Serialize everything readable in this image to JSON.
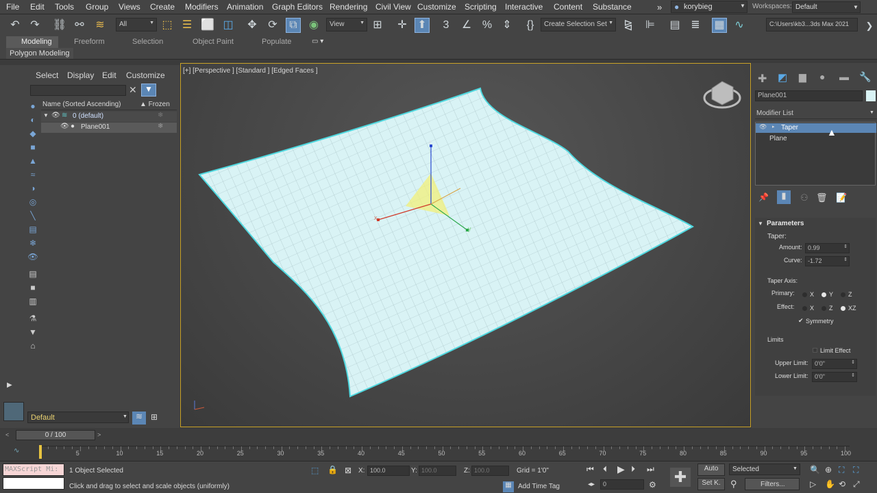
{
  "menubar": {
    "items": [
      "File",
      "Edit",
      "Tools",
      "Group",
      "Views",
      "Create",
      "Modifiers",
      "Animation",
      "Graph Editors",
      "Rendering",
      "Civil View",
      "Customize",
      "Scripting",
      "Interactive",
      "Content",
      "Substance"
    ],
    "user": "korybieg",
    "workspaces_label": "Workspaces:",
    "workspace_value": "Default"
  },
  "toolbar": {
    "filter_value": "All",
    "view_value": "View",
    "selection_set_placeholder": "Create Selection Set",
    "path": "C:\\Users\\kb3...3ds Max 2021"
  },
  "ribbon": {
    "tabs": [
      "Modeling",
      "Freeform",
      "Selection",
      "Object Paint",
      "Populate"
    ],
    "sub_label": "Polygon Modeling"
  },
  "scene_explorer": {
    "menu": [
      "Select",
      "Display",
      "Edit",
      "Customize"
    ],
    "col_name": "Name (Sorted Ascending)",
    "col_frozen": "▲ Frozen",
    "rows": [
      "0 (default)",
      "Plane001"
    ],
    "layer_value": "Default"
  },
  "viewport": {
    "label": "[+] [Perspective ] [Standard ] [Edged Faces ]",
    "gizmo_x": "x",
    "gizmo_y": "y",
    "gizmo_z": "z"
  },
  "command_panel": {
    "object_name": "Plane001",
    "modifier_list_label": "Modifier List",
    "stack": [
      "Taper",
      "Plane"
    ],
    "rollout_title": "Parameters",
    "taper_group": "Taper:",
    "amount_label": "Amount:",
    "amount_value": "0.99",
    "curve_label": "Curve:",
    "curve_value": "-1.72",
    "axis_group": "Taper Axis:",
    "primary_label": "Primary:",
    "effect_label": "Effect:",
    "primary_options": [
      "X",
      "Y",
      "Z"
    ],
    "primary_selected": "Y",
    "effect_options": [
      "X",
      "Z",
      "XZ"
    ],
    "effect_selected": "XZ",
    "symmetry_label": "Symmetry",
    "symmetry_checked": true,
    "limits_group": "Limits",
    "limit_effect_label": "Limit Effect",
    "upper_limit_label": "Upper Limit:",
    "upper_limit_value": "0'0\"",
    "lower_limit_label": "Lower Limit:",
    "lower_limit_value": "0'0\""
  },
  "timeline": {
    "frame_counter": "0 / 100",
    "ticks": [
      "0",
      "5",
      "10",
      "15",
      "20",
      "25",
      "30",
      "35",
      "40",
      "45",
      "50",
      "55",
      "60",
      "65",
      "70",
      "75",
      "80",
      "85",
      "90",
      "95",
      "100"
    ]
  },
  "status": {
    "maxscript": "MAXScript Mi:",
    "selected_text": "1 Object Selected",
    "prompt": "Click and drag to select and scale objects (uniformly)",
    "x_label": "X:",
    "x_value": "100.0",
    "y_label": "Y:",
    "y_value": "100.0",
    "z_label": "Z:",
    "z_value": "100.0",
    "grid": "Grid = 1'0\"",
    "add_time_tag": "Add Time Tag",
    "auto_label": "Auto",
    "setk_label": "Set K.",
    "selected_dropdown": "Selected",
    "filters_label": "Filters...",
    "frame_value": "0"
  },
  "colors": {
    "accent_blue": "#5b9bd5",
    "mesh_fill": "#d9f3f5",
    "mesh_edge": "#4fd8df",
    "viewport_border": "#c9a227"
  }
}
